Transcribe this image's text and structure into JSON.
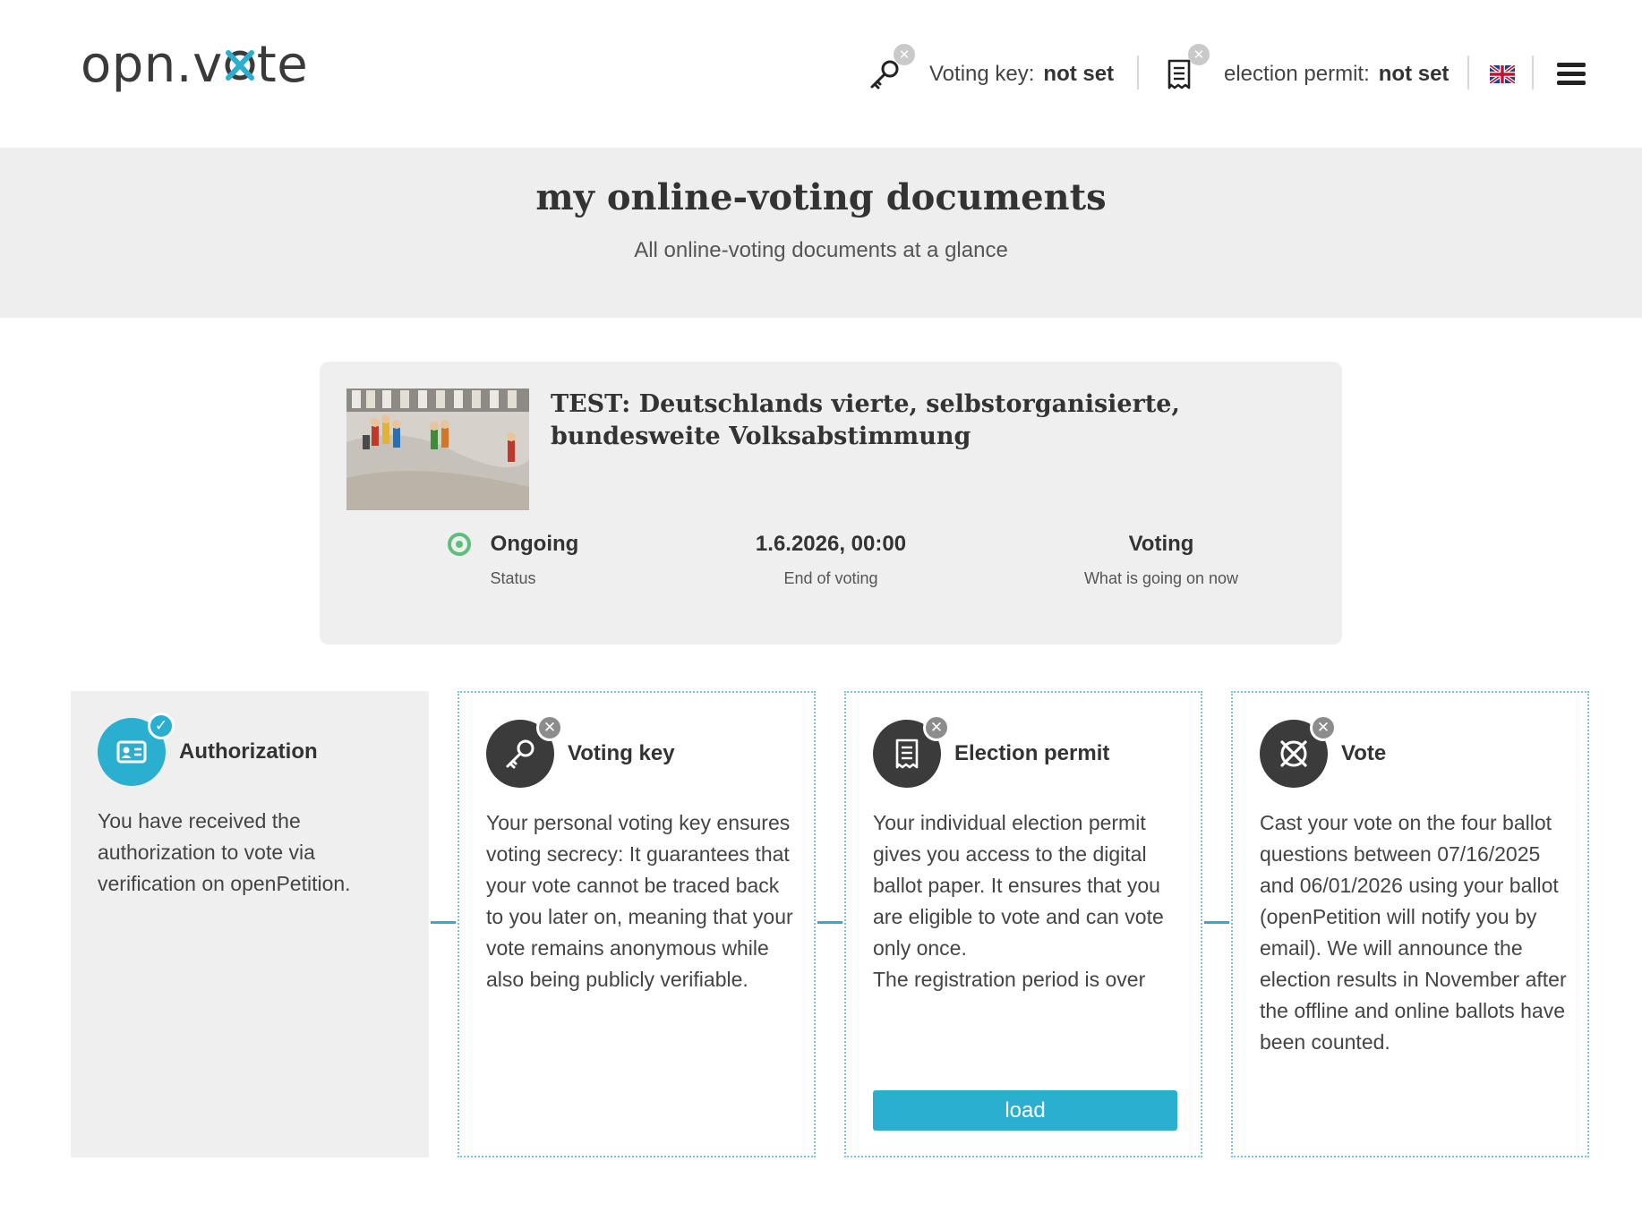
{
  "header": {
    "logo_prefix": "opn.v",
    "logo_suffix": "te",
    "voting_key": {
      "icon": "key-icon",
      "label": "Voting key:",
      "value": "not set"
    },
    "election_permit": {
      "icon": "document-icon",
      "label": "election permit:",
      "value": "not set"
    },
    "language_icon": "uk-flag-icon",
    "menu_icon": "hamburger-menu-icon"
  },
  "hero": {
    "title": "my online-voting documents",
    "subtitle": "All online-voting documents at a glance"
  },
  "petition": {
    "title": "TEST: Deutschlands vierte, selbstorganisierte, bundesweite Volksabstimmung",
    "status": {
      "value": "Ongoing",
      "label": "Status",
      "color": "#5bc07a"
    },
    "end": {
      "value": "1.6.2026, 00:00",
      "label": "End of voting"
    },
    "phase": {
      "value": "Voting",
      "label": "What is going on now"
    }
  },
  "steps": [
    {
      "title": "Authorization",
      "state": "done",
      "icon": "id-card-icon",
      "text": "You have received the authorization to vote via verification on openPetition."
    },
    {
      "title": "Voting key",
      "state": "missing",
      "icon": "key-icon",
      "text": "Your personal voting key ensures voting secrecy: It guarantees that your vote cannot be traced back to you later on, meaning that your vote remains anonymous while also being publicly verifiable."
    },
    {
      "title": "Election permit",
      "state": "missing",
      "icon": "document-icon",
      "text": "Your individual election permit gives you access to the digital ballot paper. It ensures that you are eligible to vote and can vote only once.",
      "text2": "The registration period is over",
      "button": "load"
    },
    {
      "title": "Vote",
      "state": "missing",
      "icon": "ballot-x-icon",
      "text": "Cast your vote on the four ballot questions between 07/16/2025 and 06/01/2026 using your ballot (openPetition will notify you by email). We will announce the election results in November after the offline and online ballots have been counted."
    }
  ],
  "colors": {
    "accent": "#2aafd0",
    "dark": "#3b3b3b",
    "panel": "#efefef",
    "status_green": "#5bc07a"
  }
}
